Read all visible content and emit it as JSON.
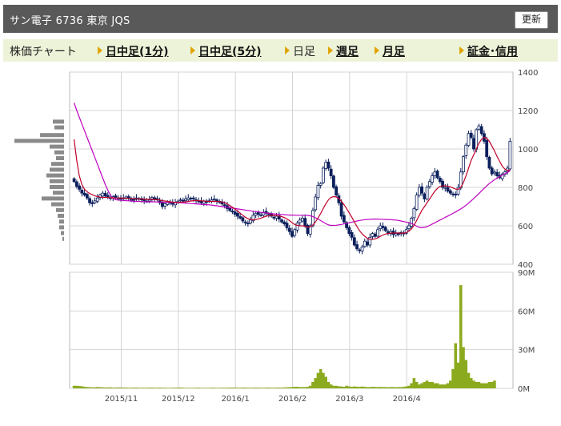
{
  "header": {
    "title": "サン電子  6736  東京 JQS",
    "update_button": "更新"
  },
  "nav": {
    "items": [
      {
        "label": "株価チャート",
        "link": false
      },
      {
        "label": "日中足(1分)",
        "link": true
      },
      {
        "label": "日中足(5分)",
        "link": true
      },
      {
        "label": "日足",
        "link": false
      },
      {
        "label": "週足",
        "link": true
      },
      {
        "label": "月足",
        "link": true
      },
      {
        "label": "証金･信用",
        "link": true
      }
    ]
  },
  "colors": {
    "up_candle": "#ffffff",
    "down_candle": "#0b1f5c",
    "ma_short": "#c0002a",
    "ma_long": "#c000c0",
    "volume_bar": "#8caa1e",
    "price_profile": "#8a8a8a",
    "grid": "#d4d4d4"
  },
  "chart_data": [
    {
      "type": "candlestick",
      "title": "",
      "ylim": [
        400,
        1400
      ],
      "yticks": [
        400,
        600,
        800,
        1000,
        1200,
        1400
      ],
      "xticks": [
        "2015/11",
        "2015/12",
        "2016/1",
        "2016/2",
        "2016/3",
        "2016/4"
      ],
      "grid": true,
      "series": [
        {
          "kind": "price",
          "close": [
            830,
            805,
            790,
            770,
            760,
            745,
            720,
            715,
            730,
            745,
            760,
            770,
            755,
            750,
            745,
            752,
            748,
            742,
            740,
            745,
            750,
            742,
            738,
            735,
            745,
            742,
            735,
            730,
            728,
            735,
            748,
            740,
            735,
            720,
            700,
            715,
            722,
            718,
            712,
            720,
            728,
            735,
            730,
            740,
            745,
            742,
            740,
            730,
            725,
            720,
            728,
            722,
            730,
            735,
            740,
            728,
            722,
            714,
            705,
            690,
            680,
            672,
            660,
            650,
            640,
            625,
            615,
            612,
            630,
            655,
            665,
            660,
            655,
            670,
            665,
            660,
            650,
            640,
            650,
            635,
            620,
            610,
            590,
            570,
            545,
            580,
            615,
            630,
            640,
            600,
            560,
            600,
            680,
            750,
            810,
            820,
            900,
            930,
            900,
            860,
            800,
            760,
            720,
            650,
            620,
            590,
            560,
            540,
            500,
            480,
            470,
            490,
            520,
            500,
            540,
            560,
            545,
            580,
            600,
            590,
            575,
            560,
            570,
            555,
            560,
            555,
            565,
            560,
            580,
            600,
            640,
            690,
            760,
            800,
            770,
            740,
            800,
            830,
            860,
            880,
            850,
            830,
            800,
            800,
            780,
            770,
            765,
            760,
            800,
            880,
            960,
            1020,
            1080,
            1060,
            1000,
            1100,
            1120,
            1080,
            1040,
            960,
            900,
            870,
            880,
            860,
            850,
            870,
            880,
            900,
            1040
          ]
        },
        {
          "kind": "ma_short",
          "values": [
            1050,
            940,
            860,
            815,
            790,
            778,
            768,
            762,
            756,
            752,
            749,
            748,
            748,
            747,
            746,
            746,
            745,
            745,
            744,
            744,
            743,
            743,
            742,
            741,
            741,
            740,
            739,
            738,
            738,
            737,
            737,
            737,
            736,
            734,
            731,
            729,
            727,
            725,
            723,
            722,
            722,
            723,
            724,
            725,
            727,
            729,
            731,
            732,
            731,
            730,
            729,
            728,
            727,
            727,
            727,
            727,
            726,
            724,
            720,
            714,
            706,
            697,
            687,
            677,
            666,
            655,
            645,
            637,
            632,
            631,
            633,
            636,
            640,
            645,
            650,
            653,
            654,
            654,
            653,
            651,
            648,
            643,
            636,
            627,
            616,
            607,
            602,
            600,
            600,
            598,
            594,
            595,
            604,
            620,
            641,
            664,
            690,
            715,
            735,
            748,
            752,
            750,
            742,
            728,
            710,
            690,
            668,
            645,
            620,
            596,
            574,
            558,
            546,
            535,
            530,
            530,
            532,
            537,
            545,
            552,
            557,
            560,
            562,
            563,
            563,
            562,
            562,
            562,
            565,
            572,
            584,
            603,
            628,
            655,
            680,
            700,
            720,
            740,
            760,
            780,
            795,
            805,
            808,
            808,
            806,
            802,
            797,
            791,
            790,
            800,
            825,
            860,
            900,
            940,
            970,
            1000,
            1030,
            1050,
            1060,
            1055,
            1040,
            1015,
            990,
            960,
            935,
            910,
            895,
            888,
            890
          ]
        },
        {
          "kind": "ma_long",
          "values": [
            1240,
            1200,
            1165,
            1130,
            1095,
            1060,
            1025,
            990,
            955,
            920,
            885,
            850,
            815,
            785,
            760,
            742,
            736,
            734,
            733,
            732,
            731,
            730,
            729,
            728,
            727,
            727,
            726,
            726,
            725,
            725,
            725,
            724,
            724,
            723,
            723,
            722,
            722,
            722,
            721,
            721,
            720,
            720,
            719,
            718,
            717,
            716,
            715,
            714,
            713,
            712,
            711,
            710,
            709,
            708,
            706,
            704,
            702,
            700,
            698,
            696,
            694,
            692,
            690,
            688,
            686,
            684,
            682,
            680,
            678,
            676,
            674,
            672,
            670,
            668,
            667,
            665,
            664,
            662,
            661,
            660,
            659,
            658,
            657,
            656,
            656,
            655,
            655,
            655,
            655,
            655,
            654,
            652,
            648,
            642,
            635,
            627,
            619,
            611,
            605,
            602,
            602,
            603,
            605,
            607,
            610,
            613,
            616,
            619,
            622,
            625,
            628,
            630,
            632,
            633,
            634,
            635,
            635,
            635,
            634,
            634,
            633,
            633,
            632,
            631,
            630,
            628,
            625,
            622,
            619,
            616,
            612,
            606,
            598,
            592,
            590,
            592,
            596,
            602,
            609,
            616,
            623,
            630,
            637,
            644,
            651,
            658,
            665,
            672,
            680,
            688,
            697,
            707,
            718,
            730,
            742,
            755,
            768,
            782,
            795,
            808,
            820,
            830,
            840,
            848,
            856,
            864,
            871,
            878,
            885
          ]
        }
      ]
    },
    {
      "type": "bar",
      "title": "",
      "ylim": [
        0,
        90
      ],
      "yticks": [
        0,
        30,
        60,
        90
      ],
      "ytick_labels": [
        "0M",
        "30M",
        "60M",
        "90M"
      ],
      "xticks": [
        "2015/11",
        "2015/12",
        "2016/1",
        "2016/2",
        "2016/3",
        "2016/4"
      ],
      "series": [
        {
          "name": "volume",
          "values": [
            2,
            2,
            1.8,
            1.6,
            1.2,
            1,
            0.9,
            0.8,
            0.8,
            1,
            0.9,
            0.8,
            0.7,
            0.7,
            0.8,
            0.6,
            0.6,
            0.7,
            0.7,
            0.6,
            0.6,
            0.5,
            0.5,
            0.6,
            0.6,
            0.5,
            0.5,
            0.5,
            0.5,
            0.6,
            0.6,
            0.5,
            0.5,
            0.6,
            0.5,
            0.5,
            0.4,
            0.4,
            0.5,
            0.5,
            0.6,
            0.6,
            0.5,
            0.4,
            0.4,
            0.4,
            0.4,
            0.5,
            0.5,
            0.4,
            0.4,
            0.4,
            0.4,
            0.5,
            0.5,
            0.4,
            0.4,
            0.5,
            0.5,
            0.5,
            0.6,
            0.6,
            0.6,
            0.5,
            0.5,
            0.6,
            0.6,
            0.5,
            0.5,
            0.5,
            0.6,
            0.5,
            0.5,
            0.5,
            0.6,
            0.6,
            0.5,
            0.5,
            0.6,
            0.6,
            0.6,
            0.7,
            0.8,
            0.9,
            1,
            1.2,
            1.2,
            1,
            1,
            1,
            1.2,
            2,
            5,
            8,
            12,
            15,
            12,
            9,
            5,
            3,
            2,
            2,
            1.6,
            1.5,
            1.2,
            2,
            1.5,
            1.2,
            1.5,
            1.3,
            1.2,
            1.4,
            1.2,
            1,
            1,
            1.2,
            1.1,
            1,
            1.1,
            1,
            1,
            0.9,
            1,
            1,
            0.9,
            1,
            1,
            1.2,
            1.5,
            2,
            4,
            8,
            5,
            3,
            4,
            5,
            6,
            5,
            5,
            4,
            4,
            3,
            3,
            3,
            4,
            6,
            15,
            35,
            20,
            80,
            32,
            22,
            12,
            8,
            6,
            5,
            5,
            4,
            4,
            4,
            5,
            5,
            6
          ]
        }
      ]
    }
  ]
}
